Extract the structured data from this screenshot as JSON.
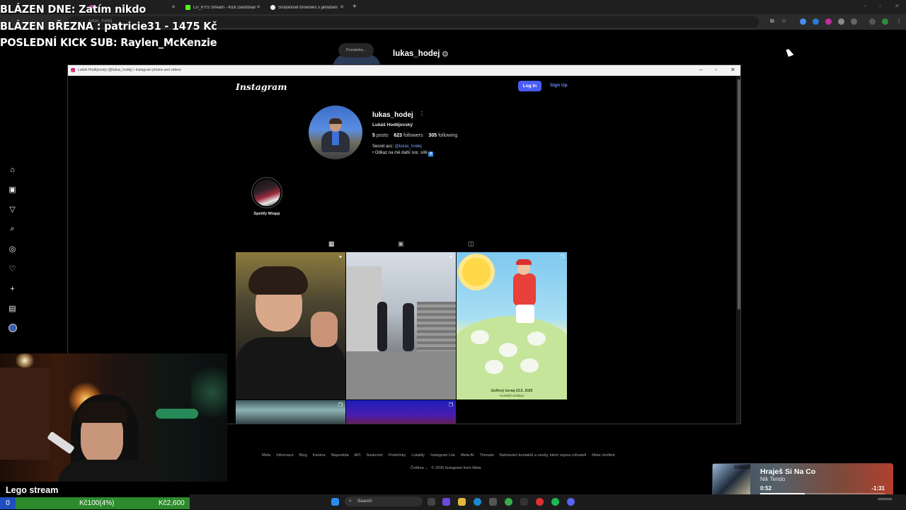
{
  "browser": {
    "tabs": [
      {
        "label": "",
        "active": false
      },
      {
        "label": "LU_KYS Stream - Kick Dashboard",
        "active": false
      },
      {
        "label": "Snídaňové brownies s jahodam",
        "active": false
      }
    ],
    "address": "lukas_hodej"
  },
  "overlay": {
    "line1": "BLÁZEN DNE: Zatím nikdo",
    "line2": "BLÁZEN BŘEZNA : patricie31 - 1475 Kč",
    "line3": "POSLEDNÍ KICK SUB: Raylen_McKenzie"
  },
  "background_page": {
    "note_bubble": "Poznámka...",
    "username": "lukas_hodej"
  },
  "popup": {
    "window_title": "Lukáš Hodějovský (@lukas_hodej) • Instagram photos and videos",
    "logo": "Instagram",
    "login_label": "Log In",
    "signup_label": "Sign Up",
    "profile": {
      "username": "lukas_hodej",
      "full_name": "Lukáš Hodějovský",
      "posts_count": "5",
      "posts_label": "posts",
      "followers_count": "623",
      "followers_label": "followers",
      "following_count": "305",
      "following_label": "following",
      "bio_prefix": "Secret acc: ",
      "bio_mention": "@lukas_hodej",
      "bio_line2": "• Odkaz na mé další soc. sítě",
      "bio_emoji": "⬇"
    },
    "highlight": {
      "label": "Spotify Wrapp"
    },
    "post3": {
      "caption": "Golfový turnaj 23.6. 2025",
      "caption2": "na twitch.tv/lukys"
    }
  },
  "footer": {
    "links": [
      "Meta",
      "Informace",
      "Blog",
      "Kariéra",
      "Nápověda",
      "API",
      "Soukromí",
      "Podmínky",
      "Lokality",
      "Instagram Lite",
      "Meta AI",
      "Threads",
      "Nahrávání kontaktů a osoby, které nejsou uživateli",
      "Meta Verified"
    ],
    "language": "Čeština",
    "copyright": "© 2026 Instagram from Meta"
  },
  "stream": {
    "title": "Lego stream",
    "goal_current": "0",
    "goal_middle": "Kč100(4%)",
    "goal_target": "Kč2,600"
  },
  "spotify": {
    "song": "Hraješ Si Na Co",
    "artist": "Nik Tendo",
    "elapsed": "0:52",
    "remaining": "-1:31",
    "progress": 0.36,
    "album_label": "S!MDO"
  },
  "taskbar": {
    "search_placeholder": "Search",
    "clock_time": "",
    "clock_date": "3/26/2026"
  },
  "colors": {
    "instagram_blue": "#4a5df9",
    "goal_green": "#2d8a2d",
    "goal_blue": "#1f4fbf"
  }
}
